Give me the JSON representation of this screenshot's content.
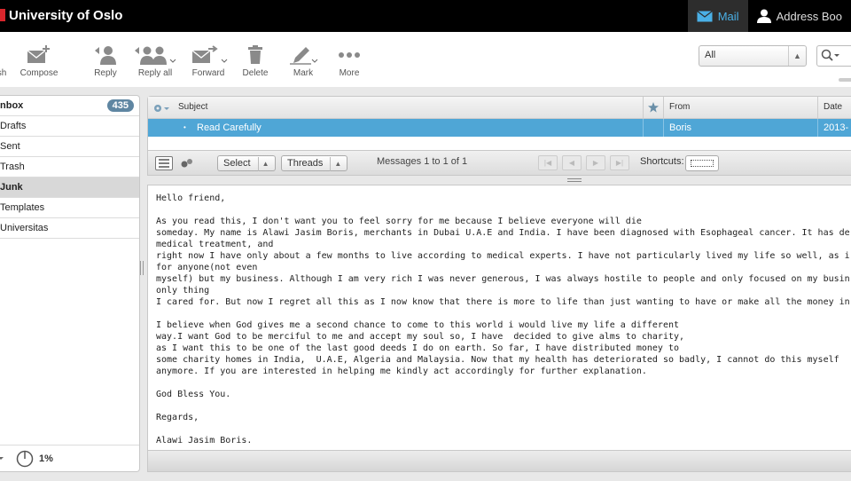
{
  "app": {
    "title": "University of Oslo",
    "brand_color": "#d9262c"
  },
  "topnav": {
    "mail_label": "Mail",
    "address_book_label": "Address Boo"
  },
  "toolbar": {
    "refresh_label": "sh",
    "compose_label": "Compose",
    "reply_label": "Reply",
    "reply_all_label": "Reply all",
    "forward_label": "Forward",
    "delete_label": "Delete",
    "mark_label": "Mark",
    "more_label": "More",
    "filter_value": "All"
  },
  "folders": [
    {
      "label": "nbox",
      "count": "435",
      "bold": true
    },
    {
      "label": "Drafts"
    },
    {
      "label": "Sent"
    },
    {
      "label": "Trash"
    },
    {
      "label": "Junk",
      "selected": true,
      "bold": true
    },
    {
      "label": "Templates"
    },
    {
      "label": "Universitas"
    }
  ],
  "quota": "1%",
  "message_list": {
    "columns": {
      "subject": "Subject",
      "from": "From",
      "date": "Date"
    },
    "rows": [
      {
        "subject": "Read Carefully",
        "from": "Boris",
        "date": "2013-0"
      }
    ],
    "select_label": "Select",
    "threads_label": "Threads",
    "count_text": "Messages 1 to 1 of 1",
    "shortcuts_label": "Shortcuts:"
  },
  "preview": {
    "body": "Hello friend,\n\nAs you read this, I don't want you to feel sorry for me because I believe everyone will die\nsomeday. My name is Alawi Jasim Boris, merchants in Dubai U.A.E and India. I have been diagnosed with Esophageal cancer. It has de\nmedical treatment, and\nright now I have only about a few months to live according to medical experts. I have not particularly lived my life so well, as i\nfor anyone(not even\nmyself) but my business. Although I am very rich I was never generous, I was always hostile to people and only focused on my busin\nonly thing\nI cared for. But now I regret all this as I now know that there is more to life than just wanting to have or make all the money in\n\nI believe when God gives me a second chance to come to this world i would live my life a different\nway.I want God to be merciful to me and accept my soul so, I have  decided to give alms to charity,\nas I want this to be one of the last good deeds I do on earth. So far, I have distributed money to\nsome charity homes in India,  U.A.E, Algeria and Malaysia. Now that my health has deteriorated so badly, I cannot do this myself\nanymore. If you are interested in helping me kindly act accordingly for further explanation.\n\nGod Bless You.\n\nRegards,\n\nAlawi Jasim Boris."
  }
}
